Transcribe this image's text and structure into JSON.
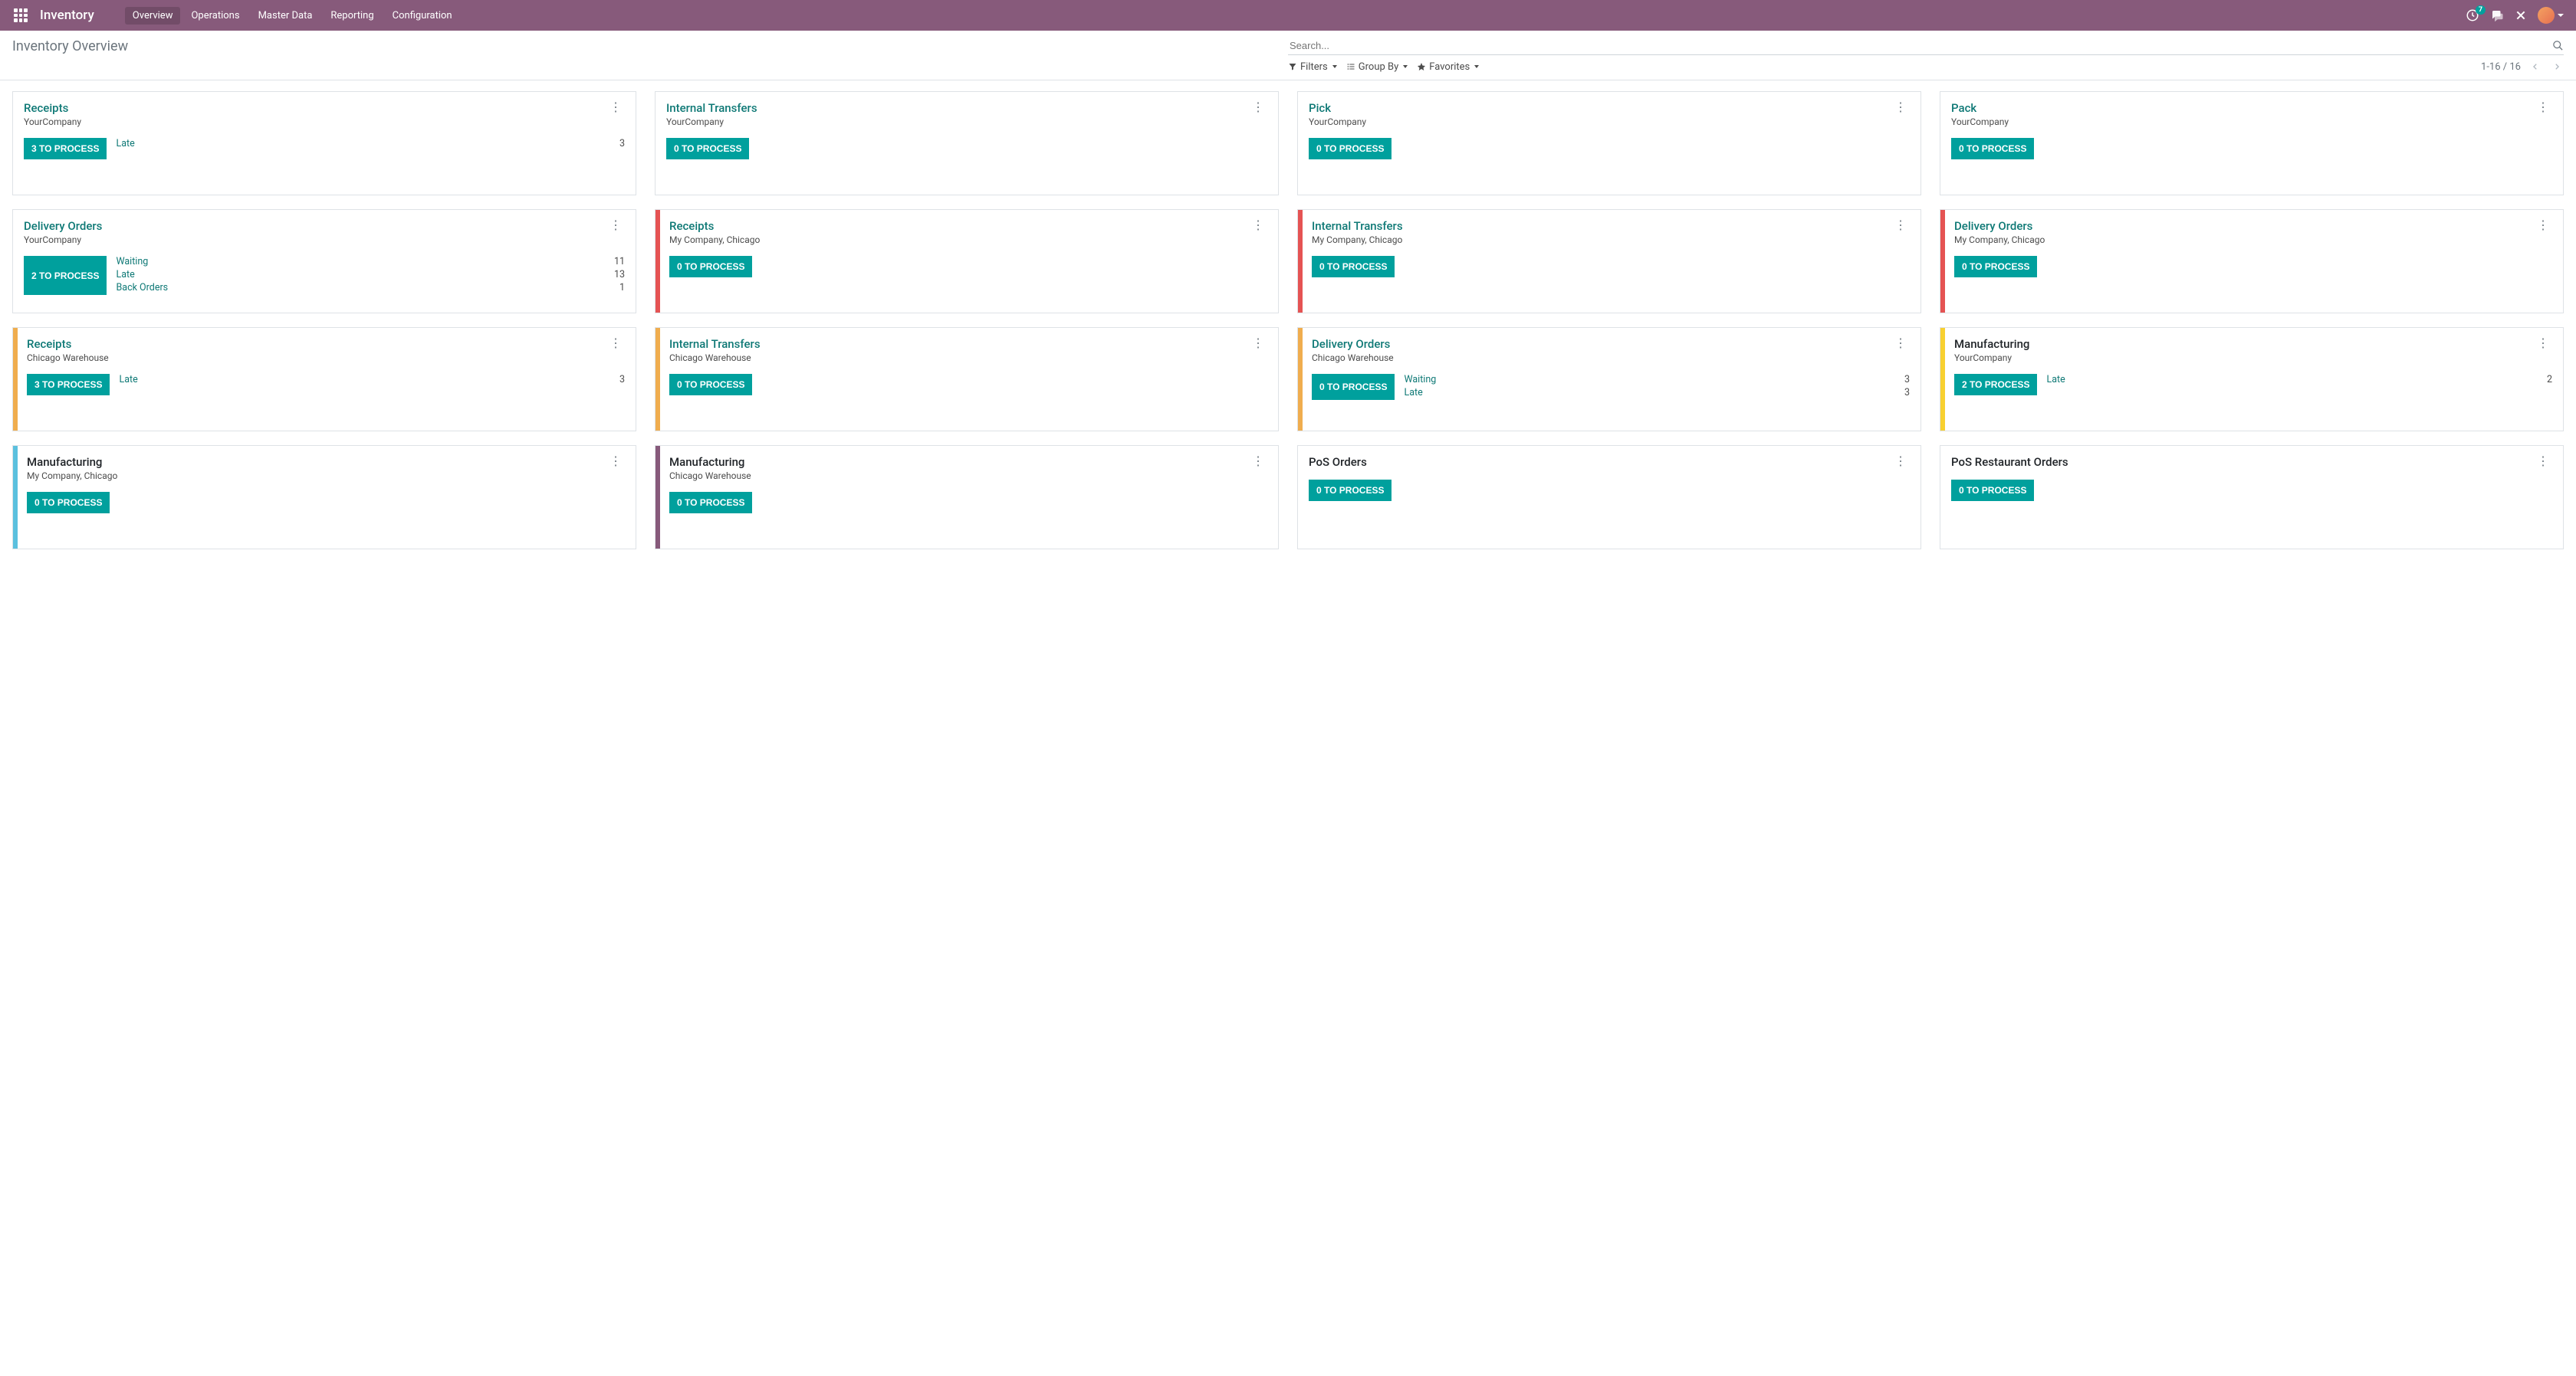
{
  "navbar": {
    "brand": "Inventory",
    "links": [
      "Overview",
      "Operations",
      "Master Data",
      "Reporting",
      "Configuration"
    ],
    "active_link": 0,
    "activity_badge": "7"
  },
  "control_panel": {
    "breadcrumb": "Inventory Overview",
    "search_placeholder": "Search...",
    "filters_label": "Filters",
    "groupby_label": "Group By",
    "favorites_label": "Favorites",
    "pager_range": "1-16",
    "pager_total": "16"
  },
  "colors": {
    "none": "",
    "red": "#e55353",
    "orange": "#f0ad4e",
    "yellow": "#f8d030",
    "blue": "#5bc0de",
    "purple": "#875A7B"
  },
  "cards": [
    {
      "title": "Receipts",
      "title_color": "teal",
      "subtitle": "YourCompany",
      "bar": "none",
      "button": "3 TO PROCESS",
      "stats": [
        {
          "label": "Late",
          "value": "3"
        }
      ]
    },
    {
      "title": "Internal Transfers",
      "title_color": "teal",
      "subtitle": "YourCompany",
      "bar": "none",
      "button": "0 TO PROCESS",
      "stats": []
    },
    {
      "title": "Pick",
      "title_color": "teal",
      "subtitle": "YourCompany",
      "bar": "none",
      "button": "0 TO PROCESS",
      "stats": []
    },
    {
      "title": "Pack",
      "title_color": "teal",
      "subtitle": "YourCompany",
      "bar": "none",
      "button": "0 TO PROCESS",
      "stats": []
    },
    {
      "title": "Delivery Orders",
      "title_color": "teal",
      "subtitle": "YourCompany",
      "bar": "none",
      "button": "2 TO PROCESS",
      "stats": [
        {
          "label": "Waiting",
          "value": "11"
        },
        {
          "label": "Late",
          "value": "13"
        },
        {
          "label": "Back Orders",
          "value": "1"
        }
      ]
    },
    {
      "title": "Receipts",
      "title_color": "teal",
      "subtitle": "My Company, Chicago",
      "bar": "red",
      "button": "0 TO PROCESS",
      "stats": []
    },
    {
      "title": "Internal Transfers",
      "title_color": "teal",
      "subtitle": "My Company, Chicago",
      "bar": "red",
      "button": "0 TO PROCESS",
      "stats": []
    },
    {
      "title": "Delivery Orders",
      "title_color": "teal",
      "subtitle": "My Company, Chicago",
      "bar": "red",
      "button": "0 TO PROCESS",
      "stats": []
    },
    {
      "title": "Receipts",
      "title_color": "teal",
      "subtitle": "Chicago Warehouse",
      "bar": "orange",
      "button": "3 TO PROCESS",
      "stats": [
        {
          "label": "Late",
          "value": "3"
        }
      ]
    },
    {
      "title": "Internal Transfers",
      "title_color": "teal",
      "subtitle": "Chicago Warehouse",
      "bar": "orange",
      "button": "0 TO PROCESS",
      "stats": []
    },
    {
      "title": "Delivery Orders",
      "title_color": "teal",
      "subtitle": "Chicago Warehouse",
      "bar": "orange",
      "button": "0 TO PROCESS",
      "stats": [
        {
          "label": "Waiting",
          "value": "3"
        },
        {
          "label": "Late",
          "value": "3"
        }
      ]
    },
    {
      "title": "Manufacturing",
      "title_color": "black",
      "subtitle": "YourCompany",
      "bar": "yellow",
      "button": "2 TO PROCESS",
      "stats": [
        {
          "label": "Late",
          "value": "2"
        }
      ]
    },
    {
      "title": "Manufacturing",
      "title_color": "black",
      "subtitle": "My Company, Chicago",
      "bar": "blue",
      "button": "0 TO PROCESS",
      "stats": []
    },
    {
      "title": "Manufacturing",
      "title_color": "black",
      "subtitle": "Chicago Warehouse",
      "bar": "purple",
      "button": "0 TO PROCESS",
      "stats": []
    },
    {
      "title": "PoS Orders",
      "title_color": "black",
      "subtitle": "",
      "bar": "none",
      "button": "0 TO PROCESS",
      "stats": []
    },
    {
      "title": "PoS Restaurant Orders",
      "title_color": "black",
      "subtitle": "",
      "bar": "none",
      "button": "0 TO PROCESS",
      "stats": []
    }
  ]
}
